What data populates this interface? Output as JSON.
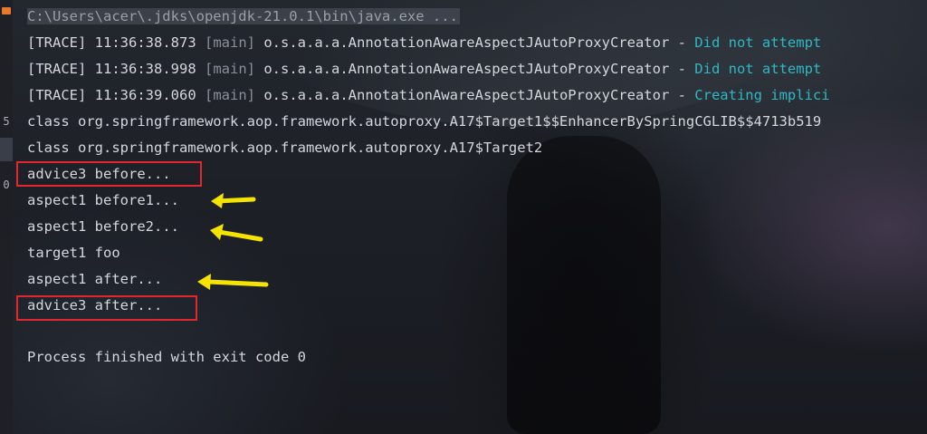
{
  "console": {
    "command": "C:\\Users\\acer\\.jdks\\openjdk-21.0.1\\bin\\java.exe ...",
    "log_lines": [
      {
        "level": "[TRACE]",
        "time": "11:36:38.873",
        "thread": "[main]",
        "logger": "o.s.a.a.a.AnnotationAwareAspectJAutoProxyCreator",
        "sep": " - ",
        "message": "Did not attempt"
      },
      {
        "level": "[TRACE]",
        "time": "11:36:38.998",
        "thread": "[main]",
        "logger": "o.s.a.a.a.AnnotationAwareAspectJAutoProxyCreator",
        "sep": " - ",
        "message": "Did not attempt"
      },
      {
        "level": "[TRACE]",
        "time": "11:36:39.060",
        "thread": "[main]",
        "logger": "o.s.a.a.a.AnnotationAwareAspectJAutoProxyCreator",
        "sep": " - ",
        "message": "Creating implici"
      }
    ],
    "output_lines": [
      "class org.springframework.aop.framework.autoproxy.A17$Target1$$EnhancerBySpringCGLIB$$4713b519",
      "class org.springframework.aop.framework.autoproxy.A17$Target2",
      "advice3 before...",
      "aspect1 before1...",
      "aspect1 before2...",
      "target1 foo",
      "aspect1 after...",
      "advice3 after..."
    ],
    "exit_message": "Process finished with exit code 0"
  },
  "gutter": {
    "marks": [
      "5",
      "0"
    ]
  },
  "colors": {
    "highlight_box": "#e0282e",
    "arrow": "#f5e400",
    "message_cyan": "#2fb8c4"
  }
}
